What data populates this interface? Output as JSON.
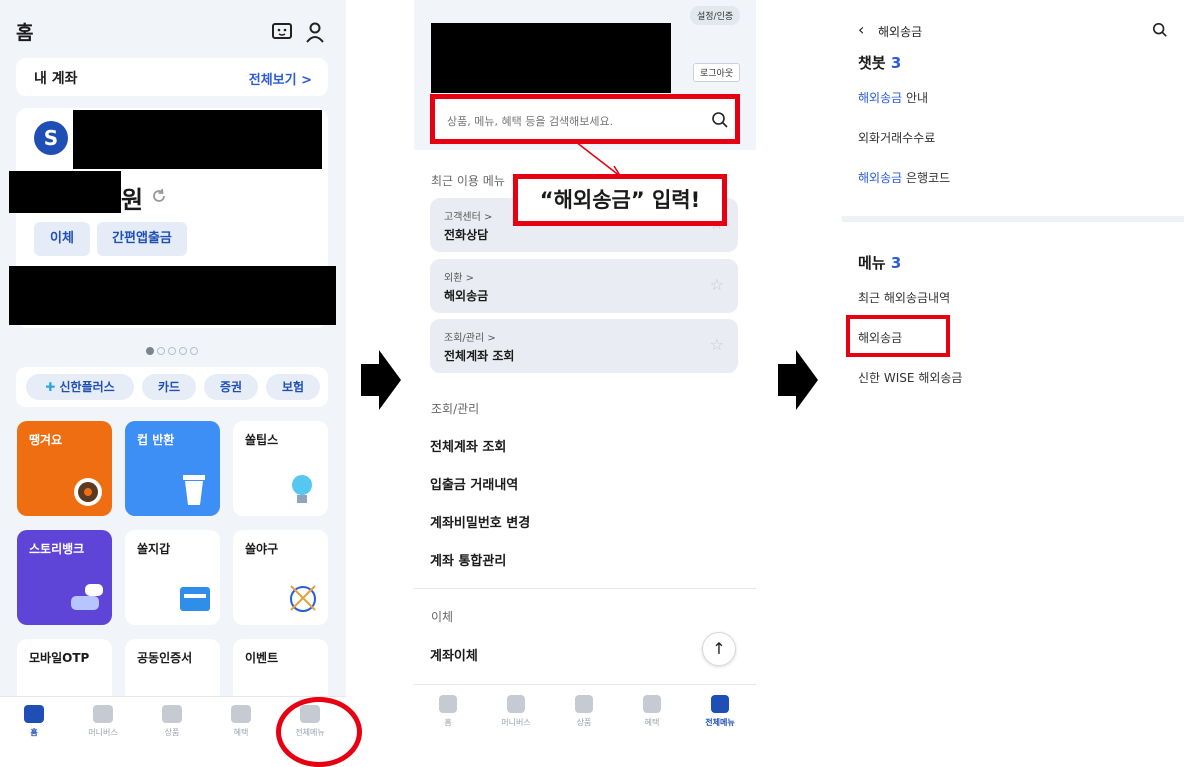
{
  "panel1": {
    "title": "홈",
    "account_header": {
      "label": "내 계좌",
      "view_all": "전체보기 >"
    },
    "account_card": {
      "amount_suffix": "원",
      "buttons": [
        "이체",
        "간편앱출금"
      ]
    },
    "carousel_pages": 5,
    "carousel_active": 1,
    "chips": [
      "신한플러스",
      "카드",
      "증권",
      "보험"
    ],
    "tiles": [
      "땡겨요",
      "컵 반환",
      "쏠팁스",
      "스토리뱅크",
      "쏠지갑",
      "쏠야구",
      "모바일OTP",
      "공동인증서",
      "이벤트"
    ],
    "tabs": [
      "홈",
      "머니버스",
      "상품",
      "혜택",
      "전체메뉴"
    ],
    "active_tab": "홈"
  },
  "panel2": {
    "settings_tag": "설정/인증",
    "logout_button": "로그아웃",
    "search_placeholder": "상품, 메뉴, 혜택 등을 검색해보세요.",
    "recent_label": "최근 이용 메뉴",
    "callout": "“해외송금” 입력!",
    "recent": [
      {
        "category": "고객센터 >",
        "title": "전화상담"
      },
      {
        "category": "외환 >",
        "title": "해외송금"
      },
      {
        "category": "조회/관리 >",
        "title": "전체계좌 조회"
      }
    ],
    "section1_label": "조회/관리",
    "section1_items": [
      "전체계좌 조회",
      "입출금 거래내역",
      "계좌비밀번호 변경",
      "계좌 통합관리"
    ],
    "section2_label": "이체",
    "section2_items": [
      "계좌이체"
    ],
    "tabs": [
      "홈",
      "머니버스",
      "상품",
      "혜택",
      "전체메뉴"
    ],
    "active_tab": "전체메뉴"
  },
  "panel3": {
    "query": "해외송금",
    "chatbot": {
      "title": "챗봇",
      "count": "3",
      "results": [
        {
          "hl": "해외송금",
          "rest": " 안내"
        },
        {
          "hl": "",
          "rest": "외화거래수수료"
        },
        {
          "hl": "해외송금",
          "rest": " 은행코드"
        }
      ]
    },
    "menu": {
      "title": "메뉴",
      "count": "3",
      "results": [
        "최근 해외송금내역",
        "해외송금",
        "신한 WISE 해외송금"
      ]
    }
  },
  "colors": {
    "accent_red": "#e60012",
    "brand_blue": "#1f4fb4",
    "link_blue": "#2b5bd6"
  }
}
